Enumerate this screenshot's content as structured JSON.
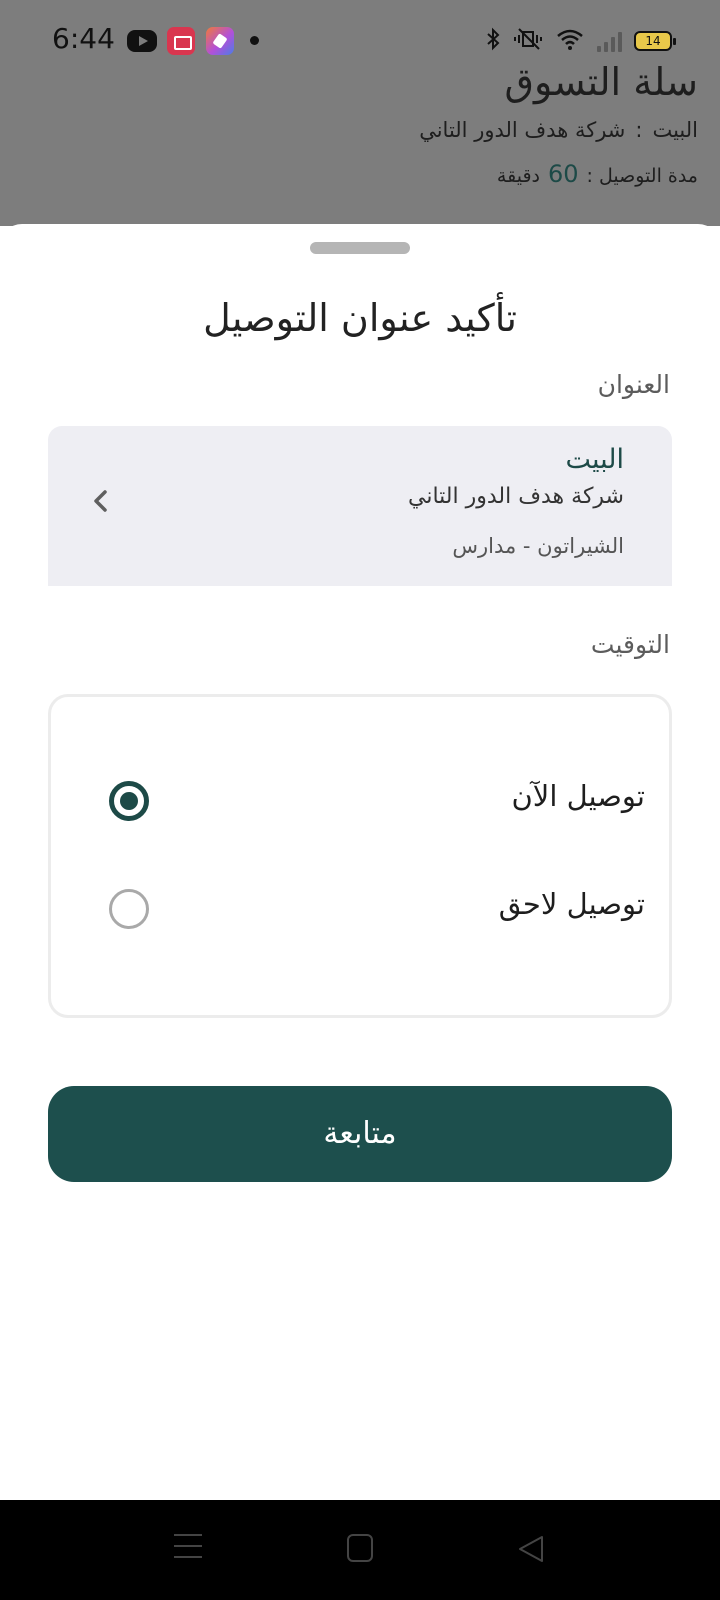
{
  "status_bar": {
    "time": "6:44",
    "battery": "14",
    "apps": [
      "youtube-icon",
      "screen-recorder-icon",
      "editor-app-icon"
    ],
    "indicators": [
      "bluetooth-icon",
      "vibrate-icon",
      "wifi-icon",
      "signal-icon",
      "battery-icon"
    ]
  },
  "background": {
    "title": "سلة التسوق",
    "address_name": "البيت",
    "address_separator": ":",
    "address_detail": "شركة هدف الدور التاني",
    "delivery_label": "مدة التوصيل :",
    "delivery_value": "60",
    "delivery_unit": "دقيقة"
  },
  "sheet": {
    "title": "تأكيد عنوان التوصيل",
    "address_label": "العنوان",
    "address": {
      "name": "البيت",
      "line": "شركة هدف الدور التاني",
      "area": "الشيراتون - مدارس"
    },
    "timing_label": "التوقيت",
    "options": [
      {
        "label": "توصيل الآن",
        "selected": true
      },
      {
        "label": "توصيل لاحق",
        "selected": false
      }
    ],
    "continue_label": "متابعة"
  },
  "colors": {
    "accent": "#1d4f4d",
    "backdrop": "#7d7d7d",
    "card_bg": "#eeeef3"
  }
}
